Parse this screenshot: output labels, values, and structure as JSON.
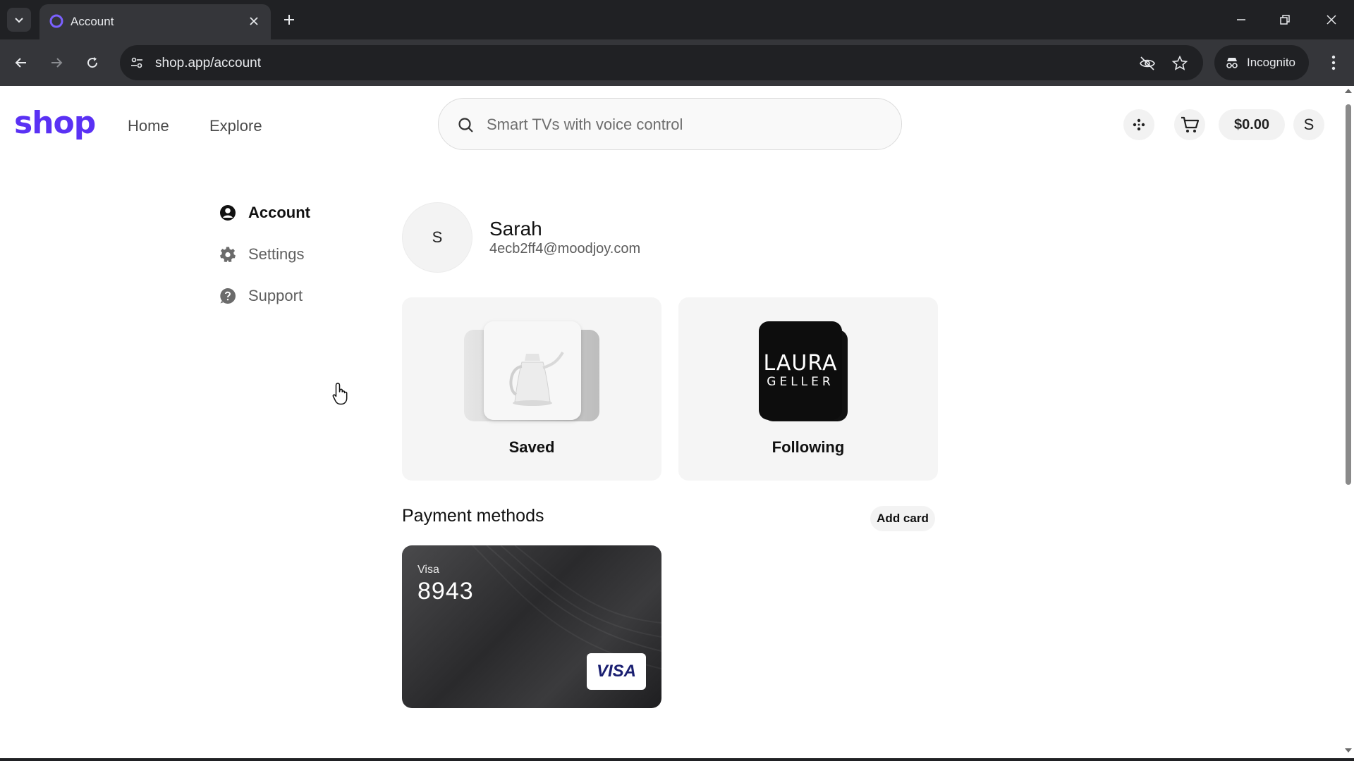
{
  "browser": {
    "tab_title": "Account",
    "url": "shop.app/account",
    "incognito_label": "Incognito"
  },
  "header": {
    "logo": "shop",
    "nav": [
      "Home",
      "Explore"
    ],
    "search_placeholder": "Smart TVs with voice control",
    "cart_total": "$0.00",
    "avatar_initial": "S"
  },
  "sidebar": {
    "items": [
      {
        "label": "Account",
        "icon": "user-circle-icon",
        "active": true
      },
      {
        "label": "Settings",
        "icon": "gear-icon",
        "active": false
      },
      {
        "label": "Support",
        "icon": "help-circle-icon",
        "active": false
      }
    ]
  },
  "profile": {
    "initial": "S",
    "name": "Sarah",
    "email": "4ecb2ff4@moodjoy.com"
  },
  "tiles": {
    "saved_label": "Saved",
    "following_label": "Following",
    "following_brand_line1": "LAURA",
    "following_brand_line2": "GELLER"
  },
  "payment": {
    "title": "Payment methods",
    "add_card_label": "Add card",
    "cards": [
      {
        "brand": "Visa",
        "last4": "8943",
        "badge": "VISA"
      }
    ]
  },
  "colors": {
    "brand": "#5a31f4",
    "visa_blue": "#1a1f71"
  }
}
